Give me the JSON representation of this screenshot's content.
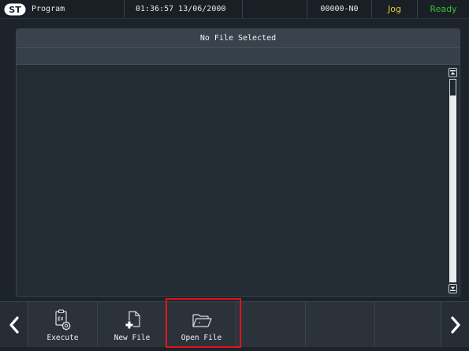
{
  "topbar": {
    "logo_text": "ST",
    "title": "Program",
    "datetime": "01:36:57 13/06/2000",
    "program": "00000-N0",
    "mode": "Jog",
    "status": "Ready"
  },
  "editor": {
    "file_title": "No File Selected"
  },
  "toolbar": {
    "execute_label": "Execute",
    "new_file_label": "New File",
    "open_file_label": "Open File"
  },
  "colors": {
    "mode": "#e7d02a",
    "status": "#2fc62f",
    "highlight": "#e0141b"
  }
}
